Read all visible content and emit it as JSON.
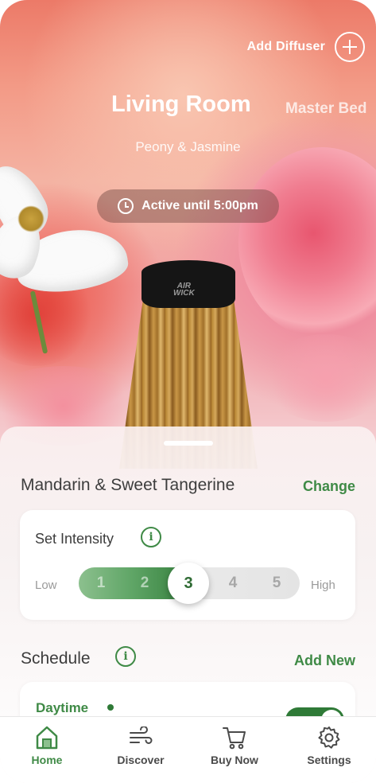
{
  "header": {
    "add_diffuser_label": "Add Diffuser",
    "room_name": "Living Room",
    "next_room_name": "Master Bed",
    "scent_name": "Peony & Jasmine",
    "active_status": "Active until 5:00pm"
  },
  "product": {
    "brand_mark_line1": "AIR",
    "brand_mark_line2": "WICK"
  },
  "fragrance": {
    "name": "Mandarin & Sweet Tangerine",
    "change_label": "Change"
  },
  "intensity": {
    "title": "Set Intensity",
    "info_glyph": "i",
    "low_label": "Low",
    "high_label": "High",
    "levels": [
      "1",
      "2",
      "3",
      "4",
      "5"
    ],
    "selected": 3
  },
  "schedule": {
    "title": "Schedule",
    "info_glyph": "i",
    "add_label": "Add New",
    "items": [
      {
        "name": "Daytime",
        "enabled": true
      }
    ]
  },
  "nav": {
    "items": [
      {
        "label": "Home",
        "icon": "home-icon",
        "active": true
      },
      {
        "label": "Discover",
        "icon": "wind-icon",
        "active": false
      },
      {
        "label": "Buy Now",
        "icon": "cart-icon",
        "active": false
      },
      {
        "label": "Settings",
        "icon": "gear-icon",
        "active": false
      }
    ]
  },
  "colors": {
    "accent": "#3f8a46",
    "accent_dark": "#2f7a37"
  }
}
